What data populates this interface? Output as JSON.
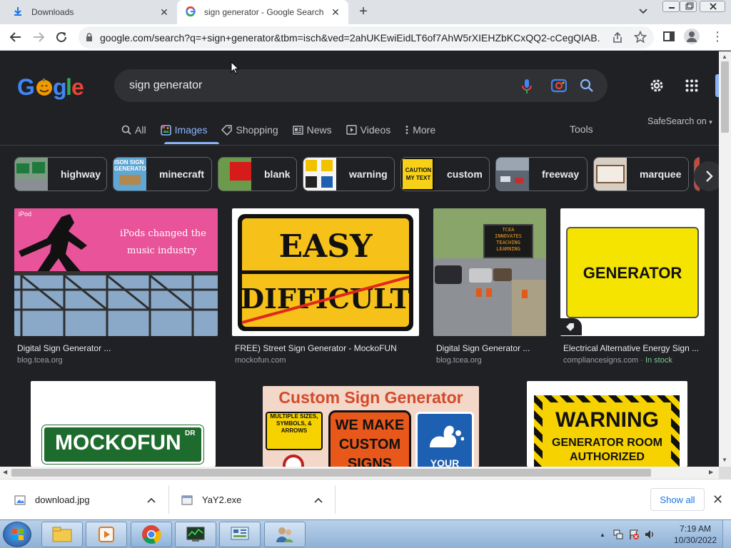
{
  "browser": {
    "tabs": [
      {
        "title": "Downloads",
        "icon": "download-icon"
      },
      {
        "title": "sign generator - Google Search",
        "icon": "google-g-icon",
        "active": true
      }
    ],
    "url": "google.com/search?q=+sign+generator&tbm=isch&ved=2ahUKEwiEidLT6of7AhW5rXIEHZbKCxQQ2-cCegQIAB..."
  },
  "google": {
    "logo_text": "Google",
    "search_query": "sign generator",
    "nav_tabs": [
      {
        "label": "All",
        "icon": "search-icon"
      },
      {
        "label": "Images",
        "icon": "image-icon",
        "active": true
      },
      {
        "label": "Shopping",
        "icon": "tag-icon"
      },
      {
        "label": "News",
        "icon": "news-icon"
      },
      {
        "label": "Videos",
        "icon": "video-icon"
      },
      {
        "label": "More",
        "icon": "kebab-icon"
      }
    ],
    "tools_label": "Tools",
    "safesearch_label": "SafeSearch on",
    "chips": [
      "highway",
      "minecraft",
      "blank",
      "warning",
      "custom",
      "freeway",
      "marquee"
    ],
    "chip_thumb_text": {
      "minecraft": "ISON SIGN GENERATO",
      "custom": "CAUTION MY TEXT"
    },
    "results": [
      {
        "title": "Digital Sign Generator ...",
        "source": "blog.tcea.org",
        "image_text": [
          "iPods changed the",
          "music industry"
        ],
        "image_badge": "iPod"
      },
      {
        "title": "FREE) Street Sign Generator - MockoFUN",
        "source": "mockofun.com",
        "image_text": [
          "EASY",
          "DIFFICULT"
        ]
      },
      {
        "title": "Digital Sign Generator ...",
        "source": "blog.tcea.org",
        "image_text": [
          "TCEA",
          "INNOVATES",
          "TEACHING",
          "LEARNING"
        ]
      },
      {
        "title": "Electrical Alternative Energy Sign ...",
        "source": "compliancesigns.com",
        "stock": "In stock",
        "image_text": [
          "GENERATOR"
        ]
      },
      {
        "title": "",
        "source": "",
        "image_text": [
          "MOCKOFUN",
          "DR"
        ]
      },
      {
        "title": "",
        "source": "",
        "image_text": [
          "Custom Sign Generator",
          "MULTIPLE SIZES, SYMBOLS, & ARROWS",
          "WE MAKE CUSTOM SIGNS",
          "YOUR"
        ]
      },
      {
        "title": "",
        "source": "",
        "image_text": [
          "WARNING",
          "GENERATOR ROOM",
          "AUTHORIZED"
        ]
      }
    ]
  },
  "downloads": {
    "items": [
      {
        "name": "download.jpg",
        "icon": "image-file-icon"
      },
      {
        "name": "YaY2.exe",
        "icon": "exe-file-icon"
      }
    ],
    "show_all_label": "Show all"
  },
  "taskbar": {
    "time": "7:19 AM",
    "date": "10/30/2022",
    "apps": [
      "explorer-icon",
      "media-player-icon",
      "chrome-icon",
      "task-manager-icon",
      "control-panel-icon",
      "users-icon"
    ]
  }
}
